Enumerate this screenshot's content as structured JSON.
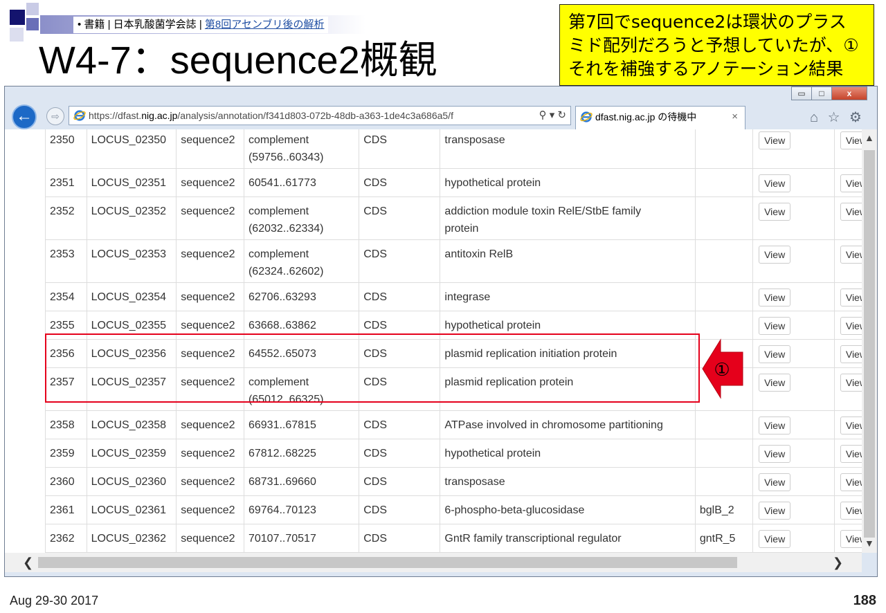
{
  "slide": {
    "breadcrumb_prefix": "• 書籍 | 日本乳酸菌学会誌 | ",
    "breadcrumb_link": "第8回アセンブリ後の解析",
    "title": "W4-7：sequence2概観",
    "callout_lines": [
      "第7回でsequence2は環状のプラス",
      "ミド配列だろうと予想していたが、①",
      "それを補強するアノテーション結果"
    ],
    "date": "Aug 29-30 2017",
    "page_number": "188",
    "arrow_label": "①"
  },
  "browser": {
    "url_prefix": "https://dfast.",
    "url_host": "nig.ac.jp",
    "url_rest": "/analysis/annotation/f341d803-072b-48db-a363-1de4c3a686a5/f",
    "url_tools": "⚲ ▾ ↻",
    "tab_title": "dfast.nig.ac.jp の待機中",
    "tab_close": "×",
    "window_buttons": [
      "▭",
      "□",
      "x"
    ],
    "toolbar_icons": "⌂ ☆ ⚙"
  },
  "table": {
    "view_label": "View",
    "rows": [
      {
        "num": "2350",
        "locus": "LOCUS_02350",
        "seq": "sequence2",
        "loc1": "complement",
        "loc2": "(59756..60343)",
        "type": "CDS",
        "product1": "transposase",
        "product2": "",
        "gene": ""
      },
      {
        "num": "2351",
        "locus": "LOCUS_02351",
        "seq": "sequence2",
        "loc1": "60541..61773",
        "loc2": "",
        "type": "CDS",
        "product1": "hypothetical protein",
        "product2": "",
        "gene": ""
      },
      {
        "num": "2352",
        "locus": "LOCUS_02352",
        "seq": "sequence2",
        "loc1": "complement",
        "loc2": "(62032..62334)",
        "type": "CDS",
        "product1": "addiction module toxin RelE/StbE family",
        "product2": "protein",
        "gene": ""
      },
      {
        "num": "2353",
        "locus": "LOCUS_02353",
        "seq": "sequence2",
        "loc1": "complement",
        "loc2": "(62324..62602)",
        "type": "CDS",
        "product1": "antitoxin RelB",
        "product2": "",
        "gene": ""
      },
      {
        "num": "2354",
        "locus": "LOCUS_02354",
        "seq": "sequence2",
        "loc1": "62706..63293",
        "loc2": "",
        "type": "CDS",
        "product1": "integrase",
        "product2": "",
        "gene": ""
      },
      {
        "num": "2355",
        "locus": "LOCUS_02355",
        "seq": "sequence2",
        "loc1": "63668..63862",
        "loc2": "",
        "type": "CDS",
        "product1": "hypothetical protein",
        "product2": "",
        "gene": ""
      },
      {
        "num": "2356",
        "locus": "LOCUS_02356",
        "seq": "sequence2",
        "loc1": "64552..65073",
        "loc2": "",
        "type": "CDS",
        "product1": "plasmid replication initiation protein",
        "product2": "",
        "gene": ""
      },
      {
        "num": "2357",
        "locus": "LOCUS_02357",
        "seq": "sequence2",
        "loc1": "complement",
        "loc2": "(65012..66325)",
        "type": "CDS",
        "product1": "plasmid replication protein",
        "product2": "",
        "gene": ""
      },
      {
        "num": "2358",
        "locus": "LOCUS_02358",
        "seq": "sequence2",
        "loc1": "66931..67815",
        "loc2": "",
        "type": "CDS",
        "product1": "ATPase involved in chromosome partitioning",
        "product2": "",
        "gene": ""
      },
      {
        "num": "2359",
        "locus": "LOCUS_02359",
        "seq": "sequence2",
        "loc1": "67812..68225",
        "loc2": "",
        "type": "CDS",
        "product1": "hypothetical protein",
        "product2": "",
        "gene": ""
      },
      {
        "num": "2360",
        "locus": "LOCUS_02360",
        "seq": "sequence2",
        "loc1": "68731..69660",
        "loc2": "",
        "type": "CDS",
        "product1": "transposase",
        "product2": "",
        "gene": ""
      },
      {
        "num": "2361",
        "locus": "LOCUS_02361",
        "seq": "sequence2",
        "loc1": "69764..70123",
        "loc2": "",
        "type": "CDS",
        "product1": "6-phospho-beta-glucosidase",
        "product2": "",
        "gene": "bglB_2"
      },
      {
        "num": "2362",
        "locus": "LOCUS_02362",
        "seq": "sequence2",
        "loc1": "70107..70517",
        "loc2": "",
        "type": "CDS",
        "product1": "GntR family transcriptional regulator",
        "product2": "",
        "gene": "gntR_5"
      }
    ]
  },
  "colors": {
    "callout_bg": "#ffff00",
    "highlight": "#e5001b",
    "ie_blue": "#1d69c6"
  }
}
